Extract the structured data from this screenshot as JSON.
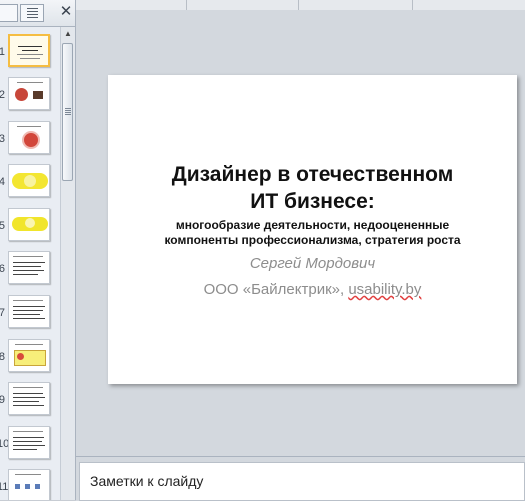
{
  "thumbnails": {
    "numbers": [
      "1",
      "2",
      "3",
      "4",
      "5",
      "6",
      "7",
      "8",
      "9",
      "10",
      "11"
    ]
  },
  "pane": {
    "close_icon": "close-icon",
    "tabs": [
      "slides-tab-icon",
      "outline-tab-icon"
    ]
  },
  "slide": {
    "title_line1": "Дизайнер в отечественном",
    "title_line2": "ИТ бизнесе:",
    "subtitle_line1": "многообразие деятельности, недооцененные",
    "subtitle_line2": "компоненты профессионализма, стратегия роста",
    "author": "Сергей Мордович",
    "company": "ООО «Байлектрик», ",
    "url": "usability.by"
  },
  "notes": {
    "placeholder": "Заметки к слайду"
  }
}
